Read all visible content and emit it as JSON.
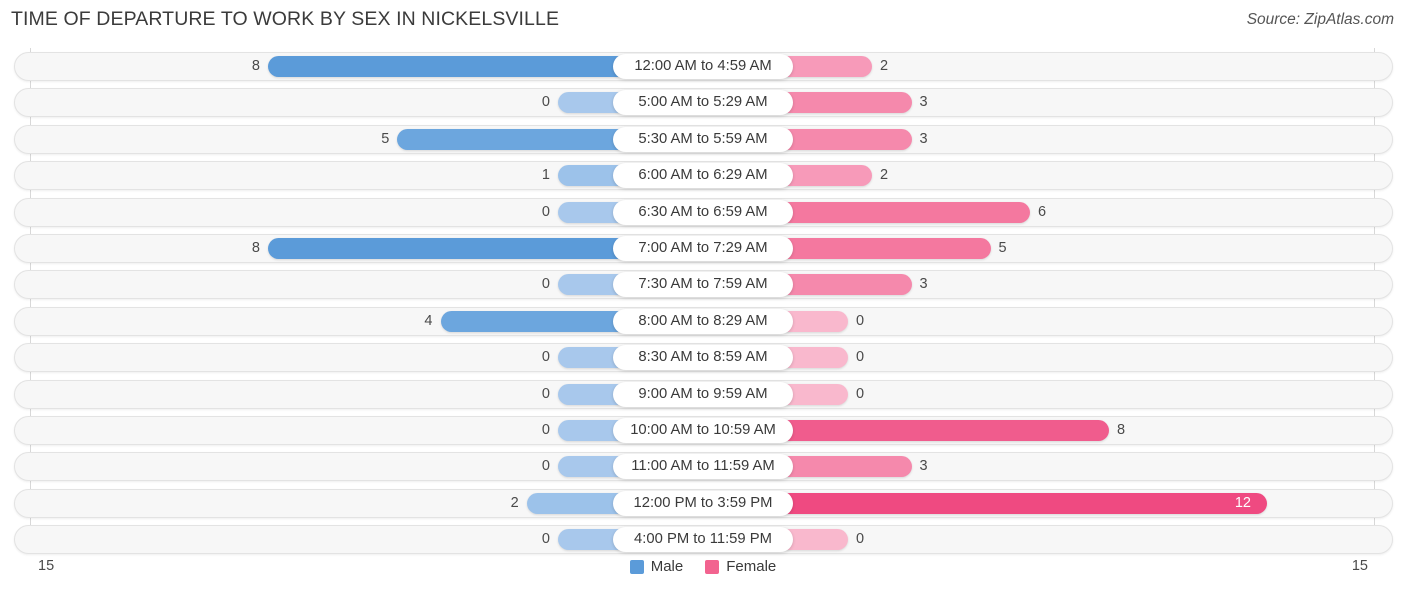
{
  "header": {
    "title": "TIME OF DEPARTURE TO WORK BY SEX IN NICKELSVILLE",
    "source": "Source: ZipAtlas.com"
  },
  "axis": {
    "left_end_label": "15",
    "right_end_label": "15"
  },
  "legend": {
    "items": [
      {
        "label": "Male",
        "color": "#5b9bd9"
      },
      {
        "label": "Female",
        "color": "#f2638f"
      }
    ]
  },
  "colors": {
    "male_strong": "#5b9bd9",
    "male_light": "#a8c8ec",
    "female_strong": "#ee5b8b",
    "female_mid": "#f4789f",
    "female_light": "#f9b8cd",
    "track_bg": "#f7f7f7",
    "track_border": "#e3e3e3",
    "gridline": "#d8d8d8",
    "text": "#3a3a3a"
  },
  "chart_data": {
    "type": "bar",
    "orientation": "horizontal-diverging",
    "title": "TIME OF DEPARTURE TO WORK BY SEX IN NICKELSVILLE",
    "xlabel": "",
    "ylabel": "",
    "xlim": [
      15,
      15
    ],
    "axis_max": 15,
    "grid": true,
    "legend_position": "bottom-center",
    "categories": [
      "12:00 AM to 4:59 AM",
      "5:00 AM to 5:29 AM",
      "5:30 AM to 5:59 AM",
      "6:00 AM to 6:29 AM",
      "6:30 AM to 6:59 AM",
      "7:00 AM to 7:29 AM",
      "7:30 AM to 7:59 AM",
      "8:00 AM to 8:29 AM",
      "8:30 AM to 8:59 AM",
      "9:00 AM to 9:59 AM",
      "10:00 AM to 10:59 AM",
      "11:00 AM to 11:59 AM",
      "12:00 PM to 3:59 PM",
      "4:00 PM to 11:59 PM"
    ],
    "series": [
      {
        "name": "Male",
        "values": [
          8,
          0,
          5,
          1,
          0,
          8,
          0,
          4,
          0,
          0,
          0,
          0,
          2,
          0
        ]
      },
      {
        "name": "Female",
        "values": [
          2,
          3,
          3,
          2,
          6,
          5,
          3,
          0,
          0,
          0,
          8,
          3,
          12,
          0
        ]
      }
    ]
  },
  "rows": [
    {
      "category": "12:00 AM to 4:59 AM",
      "male": "8",
      "female": "2"
    },
    {
      "category": "5:00 AM to 5:29 AM",
      "male": "0",
      "female": "3"
    },
    {
      "category": "5:30 AM to 5:59 AM",
      "male": "5",
      "female": "3"
    },
    {
      "category": "6:00 AM to 6:29 AM",
      "male": "1",
      "female": "2"
    },
    {
      "category": "6:30 AM to 6:59 AM",
      "male": "0",
      "female": "6"
    },
    {
      "category": "7:00 AM to 7:29 AM",
      "male": "8",
      "female": "5"
    },
    {
      "category": "7:30 AM to 7:59 AM",
      "male": "0",
      "female": "3"
    },
    {
      "category": "8:00 AM to 8:29 AM",
      "male": "4",
      "female": "0"
    },
    {
      "category": "8:30 AM to 8:59 AM",
      "male": "0",
      "female": "0"
    },
    {
      "category": "9:00 AM to 9:59 AM",
      "male": "0",
      "female": "0"
    },
    {
      "category": "10:00 AM to 10:59 AM",
      "male": "0",
      "female": "8"
    },
    {
      "category": "11:00 AM to 11:59 AM",
      "male": "0",
      "female": "3"
    },
    {
      "category": "12:00 PM to 3:59 PM",
      "male": "2",
      "female": "12"
    },
    {
      "category": "4:00 PM to 11:59 PM",
      "male": "0",
      "female": "0"
    }
  ]
}
